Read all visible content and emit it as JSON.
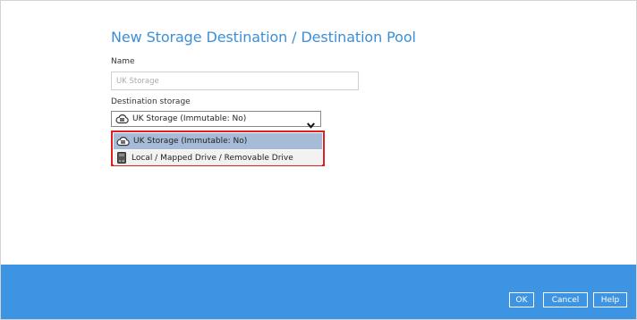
{
  "dialog": {
    "title": "New Storage Destination / Destination Pool",
    "name_label": "Name",
    "name_placeholder": "UK Storage",
    "destination_label": "Destination storage",
    "selected_value": "UK Storage (Immutable: No)",
    "options": [
      {
        "label": "UK Storage (Immutable: No)",
        "icon": "cloud-storage-icon",
        "selected": true
      },
      {
        "label": "Local / Mapped Drive / Removable Drive",
        "icon": "drive-icon",
        "selected": false
      }
    ]
  },
  "footer": {
    "ok_label": "OK",
    "cancel_label": "Cancel",
    "help_label": "Help"
  },
  "colors": {
    "title": "#3d8fd6",
    "footer_bar": "#3d94e3",
    "selected_option": "#a6bbd7",
    "highlight": "#e02020"
  }
}
